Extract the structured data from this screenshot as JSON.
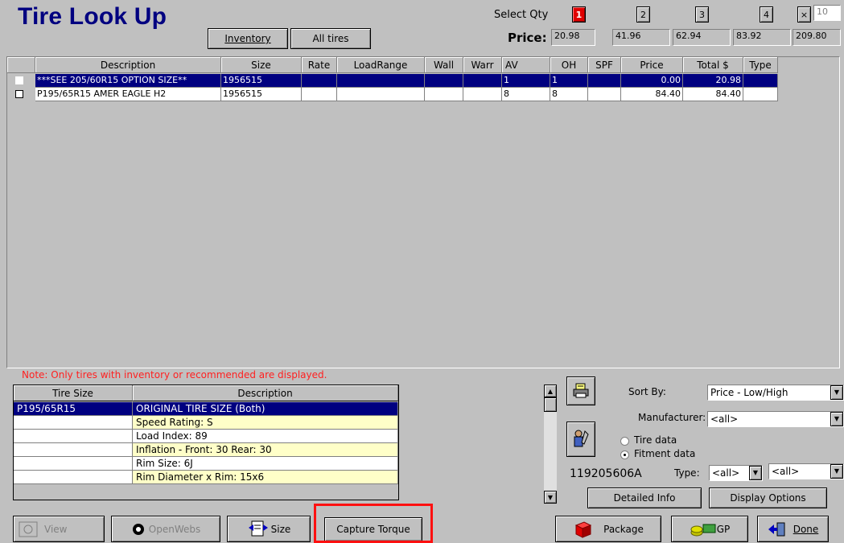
{
  "title": "Tire Look Up",
  "top_buttons": {
    "inventory": "Inventory",
    "all_tires": "All tires"
  },
  "qty": {
    "label": "Select Qty",
    "price_label": "Price:",
    "buttons": [
      "1",
      "2",
      "3",
      "4"
    ],
    "close_glyph": "×",
    "custom_qty": "10",
    "prices": [
      "20.98",
      "41.96",
      "62.94",
      "83.92",
      "209.80"
    ]
  },
  "grid": {
    "columns": [
      "Description",
      "Size",
      "Rate",
      "LoadRange",
      "Wall",
      "Warr",
      "AV",
      "OH",
      "SPF",
      "Price",
      "Total $",
      "Type"
    ],
    "rows": [
      {
        "description": "***SEE 205/60R15 OPTION SIZE**",
        "size": "1956515",
        "rate": "",
        "loadrange": "",
        "wall": "",
        "warr": "",
        "av": "1",
        "oh": "1",
        "spf": "",
        "price": "0.00",
        "total": "20.98",
        "type": ""
      },
      {
        "description": "P195/65R15 AMER EAGLE H2",
        "size": "1956515",
        "rate": "",
        "loadrange": "",
        "wall": "",
        "warr": "",
        "av": "8",
        "oh": "8",
        "spf": "",
        "price": "84.40",
        "total": "84.40",
        "type": ""
      }
    ]
  },
  "note": "Note: Only tires with inventory or recommended are displayed.",
  "detail": {
    "columns": [
      "Tire Size",
      "Description"
    ],
    "rows": [
      {
        "size": "P195/65R15",
        "desc": "ORIGINAL TIRE SIZE (Both)"
      },
      {
        "size": "",
        "desc": "Speed Rating: S"
      },
      {
        "size": "",
        "desc": "Load Index: 89"
      },
      {
        "size": "",
        "desc": "Inflation - Front: 30 Rear: 30"
      },
      {
        "size": "",
        "desc": "Rim Size: 6J"
      },
      {
        "size": "",
        "desc": "Rim Diameter x Rim: 15x6"
      }
    ]
  },
  "options": {
    "sort_by_label": "Sort By:",
    "sort_by_value": "Price - Low/High",
    "manufacturer_label": "Manufacturer:",
    "manufacturer_value": "<all>",
    "radio_tire": "Tire data",
    "radio_fitment": "Fitment data",
    "part_number": "119205606A",
    "type_label": "Type:",
    "type_value": "<all>",
    "type_value2": "<all>",
    "detailed_info": "Detailed Info",
    "display_options": "Display Options"
  },
  "bottom": {
    "view": "View",
    "openwebs": "OpenWebs",
    "size": "Size",
    "capture_torque": "Capture Torque",
    "package": "Package",
    "gp": "GP",
    "done": "Done"
  }
}
